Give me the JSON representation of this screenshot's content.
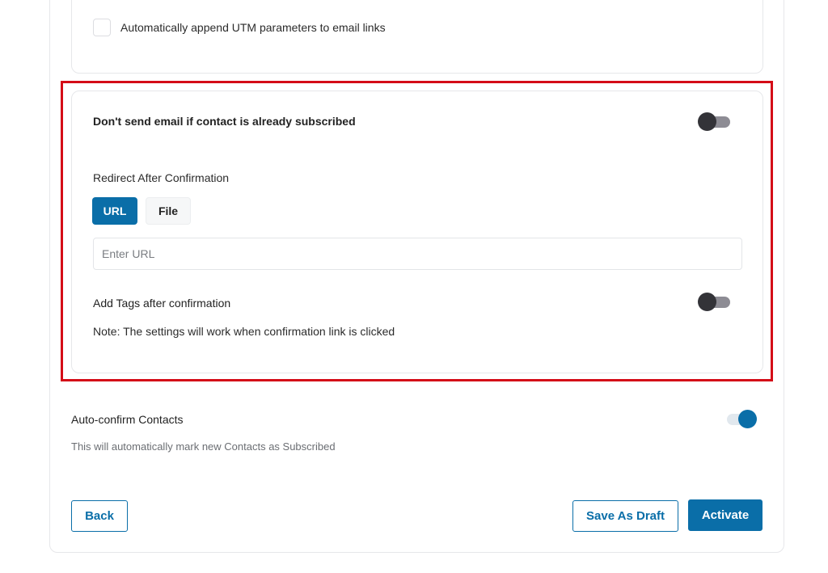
{
  "utm": {
    "checkbox_checked": false,
    "label": "Automatically append UTM parameters to email links"
  },
  "confirmation_settings": {
    "dont_send_if_subscribed": {
      "label": "Don't send email if contact is already subscribed",
      "enabled": false
    },
    "redirect": {
      "label": "Redirect After Confirmation",
      "options": [
        {
          "label": "URL",
          "active": true
        },
        {
          "label": "File",
          "active": false
        }
      ],
      "url_input": {
        "value": "",
        "placeholder": "Enter URL"
      }
    },
    "add_tags": {
      "label": "Add Tags after confirmation",
      "enabled": false
    },
    "note": "Note: The settings will work when confirmation link is clicked"
  },
  "auto_confirm": {
    "label": "Auto-confirm Contacts",
    "description": "This will automatically mark new Contacts as Subscribed",
    "enabled": true
  },
  "footer": {
    "back_label": "Back",
    "save_draft_label": "Save As Draft",
    "activate_label": "Activate"
  },
  "colors": {
    "primary": "#0a6ea8",
    "highlight": "#d40c17"
  }
}
